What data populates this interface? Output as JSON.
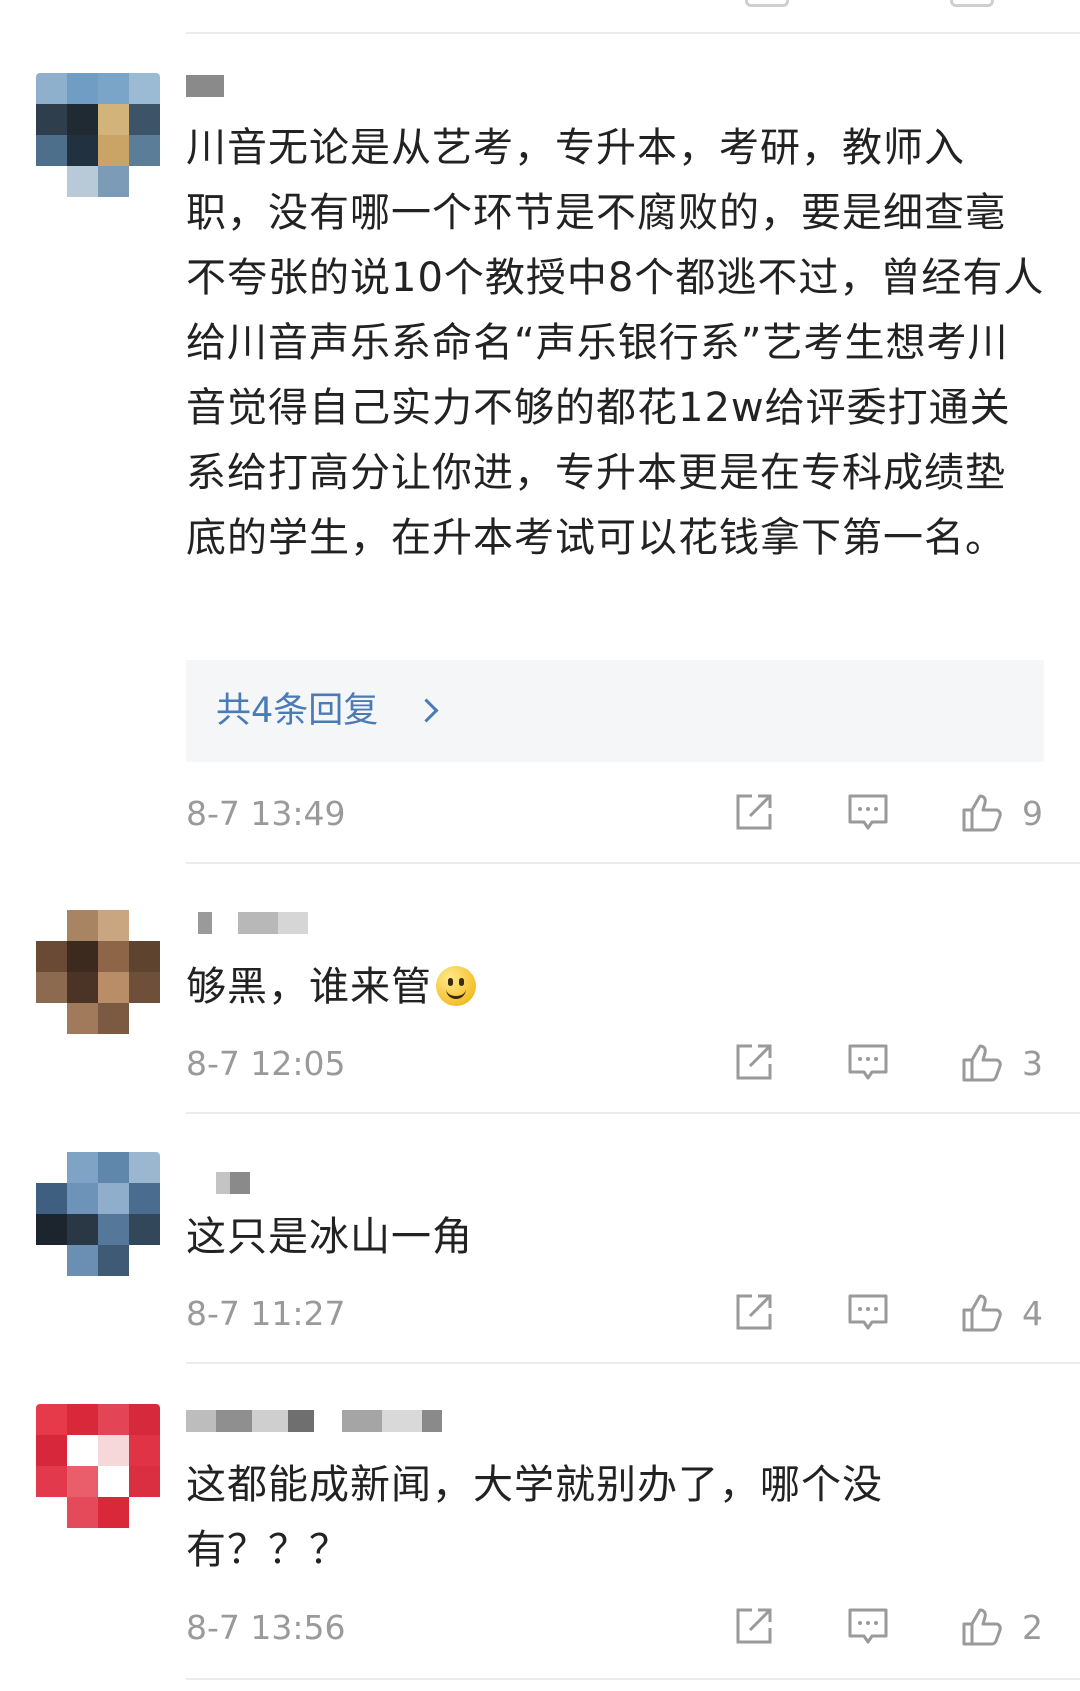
{
  "colors": {
    "text": "#222222",
    "meta": "#9a9a9a",
    "link": "#4a7bb7",
    "reply_box_bg": "#f5f6f8",
    "divider": "#ececec"
  },
  "action_icons": [
    "share-icon",
    "comment-icon",
    "like-icon"
  ],
  "comments": [
    {
      "avatar_icon": "pixelated-avatar-icon",
      "username": "",
      "text": "川音无论是从艺考，专升本，考研，教师入职，没有哪一个环节是不腐败的，要是细查毫不夸张的说10个教授中8个都逃不过，曾经有人给川音声乐系命名“声乐银行系”艺考生想考川音觉得自己实力不够的都花12w给评委打通关系给打高分让你进，专升本更是在专科成绩垫底的学生，在升本考试可以花钱拿下第一名。",
      "replies_label": "共4条回复",
      "timestamp": "8-7 13:49",
      "likes": "9"
    },
    {
      "avatar_icon": "pixelated-avatar-icon",
      "username": "",
      "text": "够黑，谁来管",
      "emoji": "smile-emoji-icon",
      "timestamp": "8-7 12:05",
      "likes": "3"
    },
    {
      "avatar_icon": "pixelated-avatar-icon",
      "username": "",
      "text": "这只是冰山一角",
      "timestamp": "8-7 11:27",
      "likes": "4"
    },
    {
      "avatar_icon": "pixelated-avatar-icon",
      "username": "",
      "text": "这都能成新闻，大学就别办了，哪个没有？？？",
      "timestamp": "8-7 13:56",
      "likes": "2"
    }
  ]
}
